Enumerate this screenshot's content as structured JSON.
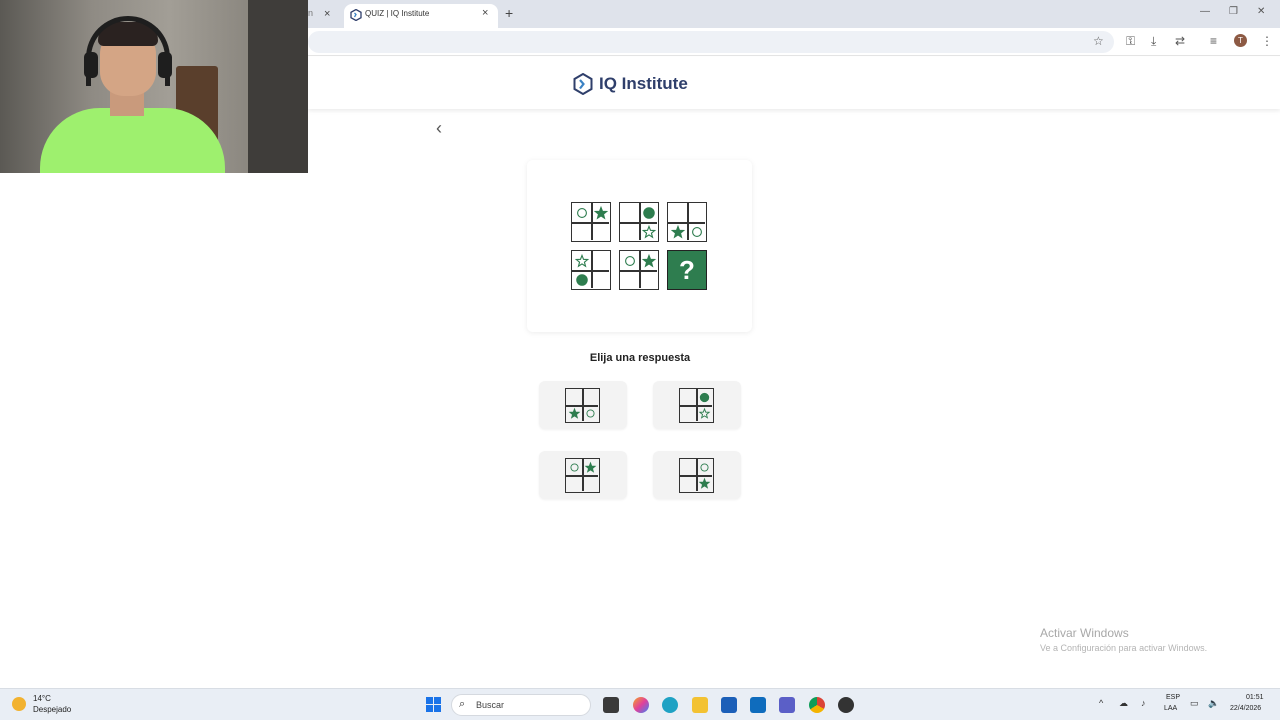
{
  "browser": {
    "prev_tab_fragment": "n",
    "active_tab_title": "QUIZ | IQ Institute",
    "new_tab_symbol": "+",
    "close_symbol": "×",
    "profile_initial": "T"
  },
  "site": {
    "brand_name": "IQ Institute",
    "back_symbol": "‹"
  },
  "puzzle": {
    "question_mark": "?",
    "accent_color": "#2e7d4f",
    "grid": [
      [
        "circle-outline",
        "star-filled",
        "",
        ""
      ],
      [
        "",
        "circle-filled",
        "",
        "star-outline"
      ],
      [
        "",
        "",
        "star-filled",
        "circle-outline"
      ],
      [
        "star-outline",
        "",
        "circle-filled",
        ""
      ],
      [
        "circle-outline",
        "star-filled",
        "",
        ""
      ]
    ]
  },
  "prompt": "Elija una respuesta",
  "options": [
    [
      "",
      "",
      "star-filled",
      "circle-outline"
    ],
    [
      "",
      "circle-filled",
      "",
      "star-outline"
    ],
    [
      "circle-outline",
      "star-filled",
      "",
      ""
    ],
    [
      "",
      "circle-outline",
      "",
      "star-filled"
    ]
  ],
  "watermark": {
    "title": "Activar Windows",
    "subtitle": "Ve a Configuración para activar Windows."
  },
  "taskbar": {
    "temperature": "14°C",
    "weather": "Despejado",
    "search_placeholder": "Buscar",
    "lang_top": "ESP",
    "lang_bottom": "LAA",
    "time": "01:51",
    "date": "22/4/2026"
  }
}
